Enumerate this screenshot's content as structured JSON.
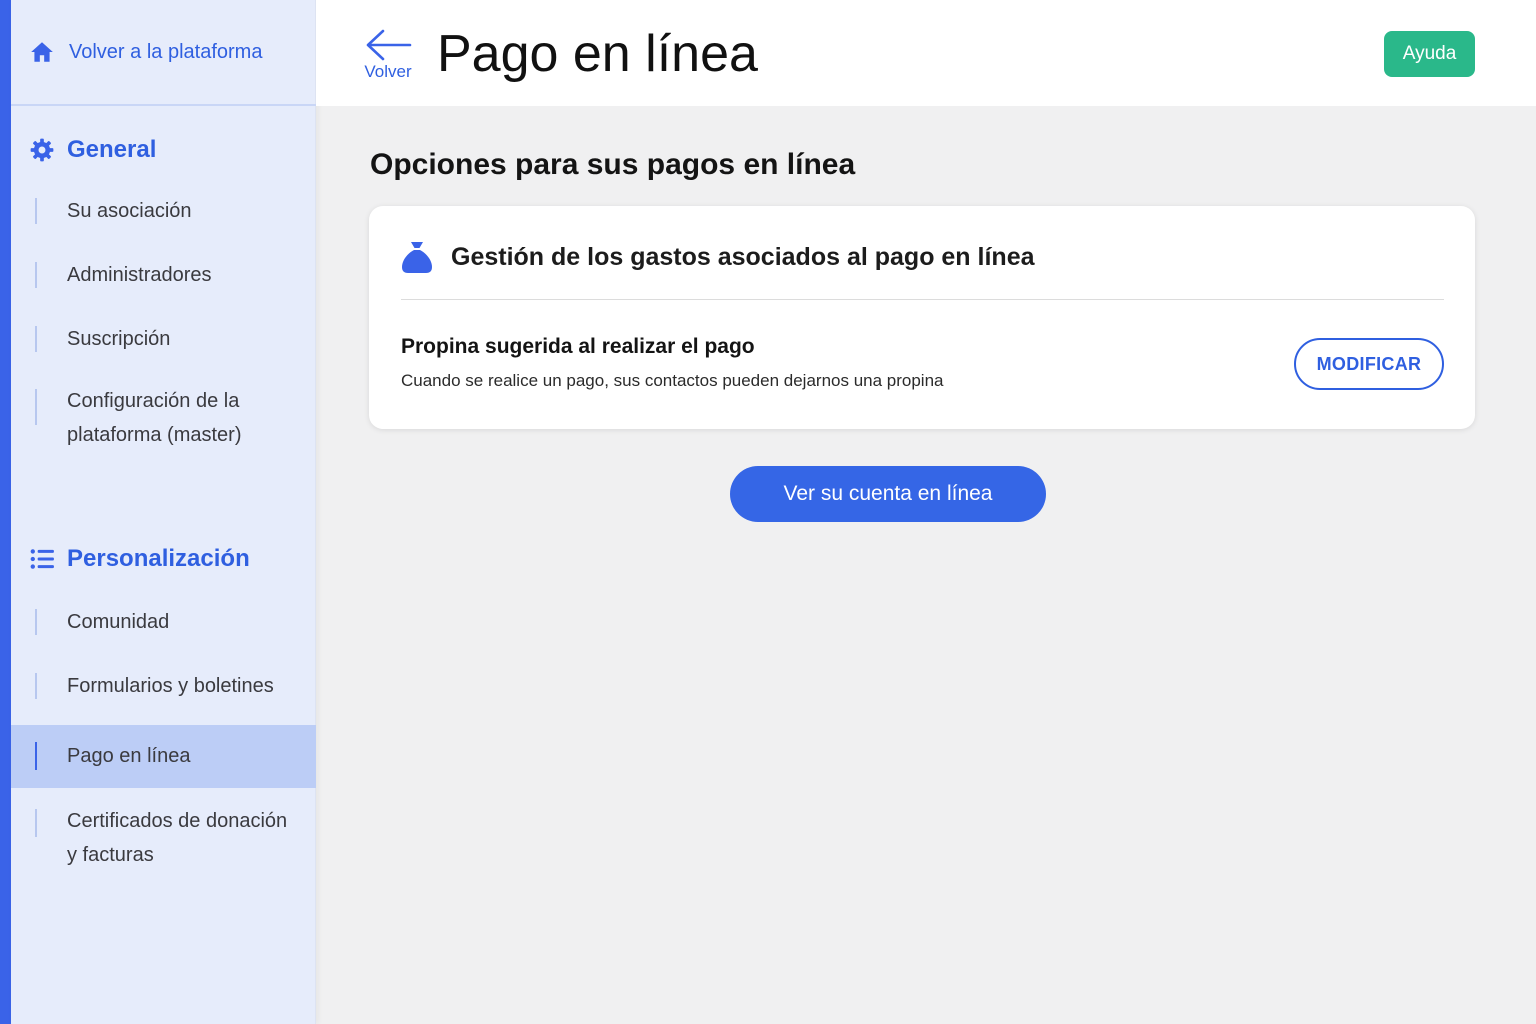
{
  "sidebar": {
    "back_link": "Volver a la plataforma",
    "general": {
      "title": "General",
      "items": [
        "Su asociación",
        "Administradores",
        "Suscripción",
        "Configuración de la plataforma (master)"
      ]
    },
    "personalizacion": {
      "title": "Personalización",
      "items": [
        "Comunidad",
        "Formularios y boletines",
        "Pago en línea",
        "Certificados de donación y facturas"
      ],
      "active_item": "Pago en línea"
    }
  },
  "header": {
    "back_label": "Volver",
    "title": "Pago en línea",
    "help_label": "Ayuda"
  },
  "main": {
    "section_title": "Opciones para sus pagos en línea",
    "card": {
      "title": "Gestión de los gastos asociados al pago en línea",
      "setting_title": "Propina sugerida al realizar el pago",
      "setting_description": "Cuando se realice un pago, sus contactos pueden dejarnos una propina",
      "modify_label": "MODIFICAR"
    },
    "account_button": "Ver su cuenta en línea"
  },
  "colors": {
    "accent": "#3a63e8",
    "help": "#2ab88a",
    "sidebar_bg": "#e6ecfb",
    "active_item_bg": "#bccdf6"
  },
  "icons": {
    "back_link": "home-icon",
    "general": "gear-icon",
    "personalizacion": "list-icon",
    "back": "arrow-left-icon",
    "card": "money-bag-icon"
  }
}
